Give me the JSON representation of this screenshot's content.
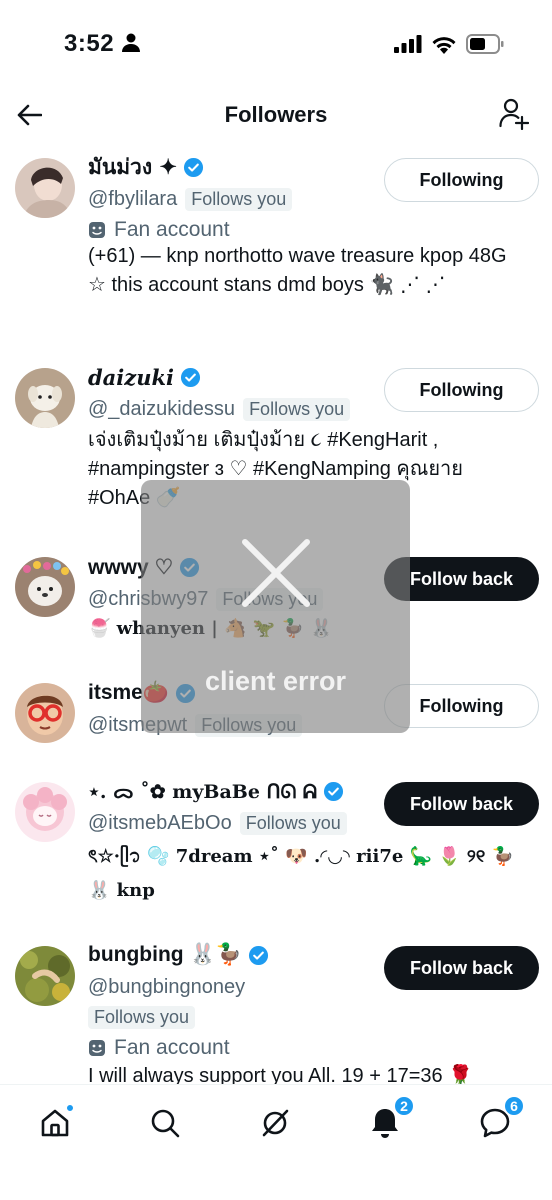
{
  "status_bar": {
    "time": "3:52"
  },
  "header": {
    "title": "Followers"
  },
  "follows_you_label": "Follows you",
  "fan_account_label": "Fan account",
  "accounts": [
    {
      "name": "มันม่วง ✦",
      "handle": "@fbylilara",
      "button": "Following",
      "bio": "(+61)   — knp northotto wave treasure kpop 48G ☆          this account stans dmd boys 🐈‍⬛ ⋰ ⋰"
    },
    {
      "name": "daizuki",
      "handle": "@_daizukidessu",
      "button": "Following",
      "bio": "เจ่งเติมปุ๋งม้าย เติมปุ๋งม้าย ૮ #KengHarit , #nampingster ɜ ♡ #KengNamping คุณยาย #OhAe 🍼"
    },
    {
      "name": "wwwy ♡",
      "handle": "@chrisbwy97",
      "button": "Follow back",
      "bio": "🍧 whanyen | 🐴 🦖 🦆 🐰"
    },
    {
      "name": "itsme🍅",
      "handle": "@itsmepwt",
      "button": "Following",
      "bio": ""
    },
    {
      "name": "⋆. ᯅ ˚✿ myBaBe ᑎᘏ ᕱ",
      "handle": "@itsmebAEbOo",
      "button": "Follow back",
      "bio": "ৎ☆·ᥫ᭡ 🫧 7dream ⋆˚ 🐶 .◜◡◝ rii7e 🦕 🌷 ୨୧ 🦆 🐰 knp"
    },
    {
      "name": "bungbing 🐰🦆",
      "handle": "@bungbingnoney",
      "button": "Follow back",
      "bio": "I will always support you All. 19 + 17=36 🌹"
    }
  ],
  "tabs": {
    "home": {
      "label": "Home"
    },
    "search": {
      "label": "Search"
    },
    "grok": {
      "label": "Grok"
    },
    "notifications": {
      "label": "Notifications",
      "badge": "2"
    },
    "messages": {
      "label": "Messages",
      "badge": "6"
    }
  },
  "error_overlay": {
    "text": "client error"
  },
  "colors": {
    "accent": "#1d9bf0",
    "text": "#0f1419",
    "muted": "#536471",
    "button_dark": "#0f1419"
  }
}
